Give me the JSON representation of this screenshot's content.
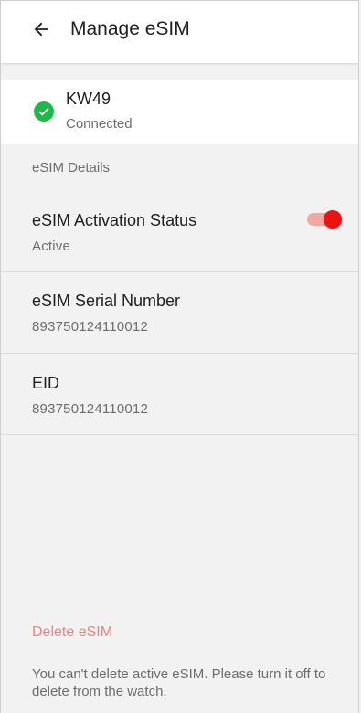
{
  "header": {
    "title": "Manage eSIM",
    "back_icon": "arrow-left-icon"
  },
  "device": {
    "name": "KW49",
    "status": "Connected",
    "status_icon": "check-circle-icon",
    "status_color": "#1fb94a"
  },
  "details": {
    "section_label": "eSIM Details",
    "activation": {
      "title": "eSIM Activation Status",
      "value": "Active",
      "toggle_on": true,
      "toggle_color": "#ee1111"
    },
    "serial": {
      "title": "eSIM Serial Number",
      "value": "893750124110012"
    },
    "eid": {
      "title": "EID",
      "value": "893750124110012"
    }
  },
  "delete": {
    "label": "Delete eSIM",
    "note": "You can't delete active eSIM. Please turn it off to delete from the watch.",
    "color": "#f08080"
  }
}
